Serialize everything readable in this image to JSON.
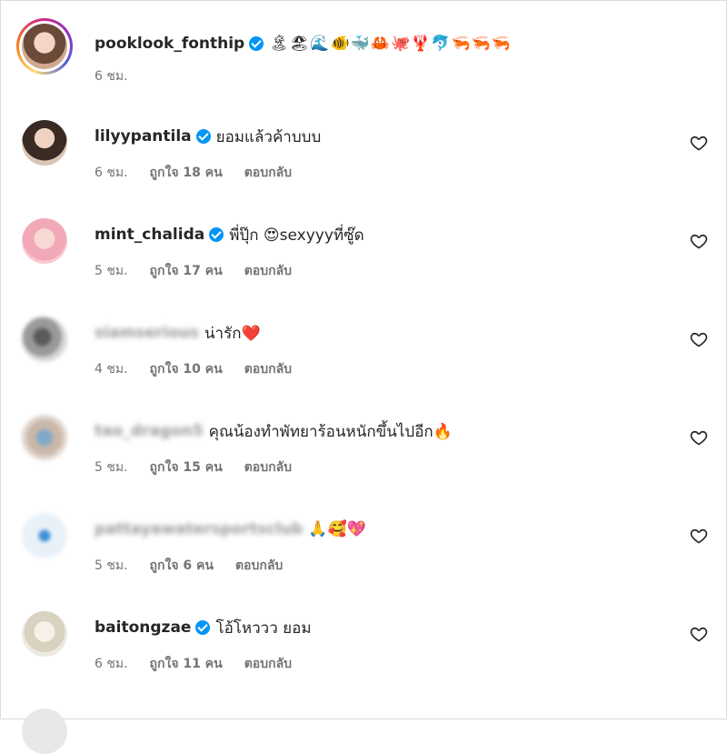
{
  "post": {
    "username": "pooklook_fonthip",
    "caption_emojis": "🏝🏖🌊🐠🐳🦀🐙🦞🐬🦐🦐🦐",
    "time": "6 ชม."
  },
  "comments": [
    {
      "username": "lilyypantila",
      "verified": true,
      "text": "ยอมแล้วค้าบบบ",
      "time": "6 ชม.",
      "likes": "ถูกใจ 18 คน",
      "reply": "ตอบกลับ"
    },
    {
      "username": "mint_chalida",
      "verified": true,
      "text": "พี่ปุ๊ก 😍sexyyyที่ซู๊ด",
      "time": "5 ชม.",
      "likes": "ถูกใจ 17 คน",
      "reply": "ตอบกลับ"
    },
    {
      "username": "siamserious",
      "verified": false,
      "text": "น่ารัก❤️",
      "time": "4 ชม.",
      "likes": "ถูกใจ 10 คน",
      "reply": "ตอบกลับ"
    },
    {
      "username": "tao_dragon5",
      "verified": false,
      "text": "คุณน้องทำพัทยาร้อนหนักขึ้นไปอีก🔥",
      "time": "5 ชม.",
      "likes": "ถูกใจ 15 คน",
      "reply": "ตอบกลับ"
    },
    {
      "username": "pattayawatersportsclub",
      "verified": false,
      "text": "🙏🥰💖",
      "time": "5 ชม.",
      "likes": "ถูกใจ 6 คน",
      "reply": "ตอบกลับ"
    },
    {
      "username": "baitongzae",
      "verified": true,
      "text": "โอ้โหววว ยอม",
      "time": "6 ชม.",
      "likes": "ถูกใจ 11 คน",
      "reply": "ตอบกลับ"
    }
  ],
  "icons": {
    "like": "heart-outline-icon",
    "verified": "verified-badge-icon"
  },
  "colors": {
    "verified": "#0095f6",
    "meta": "#737373"
  }
}
